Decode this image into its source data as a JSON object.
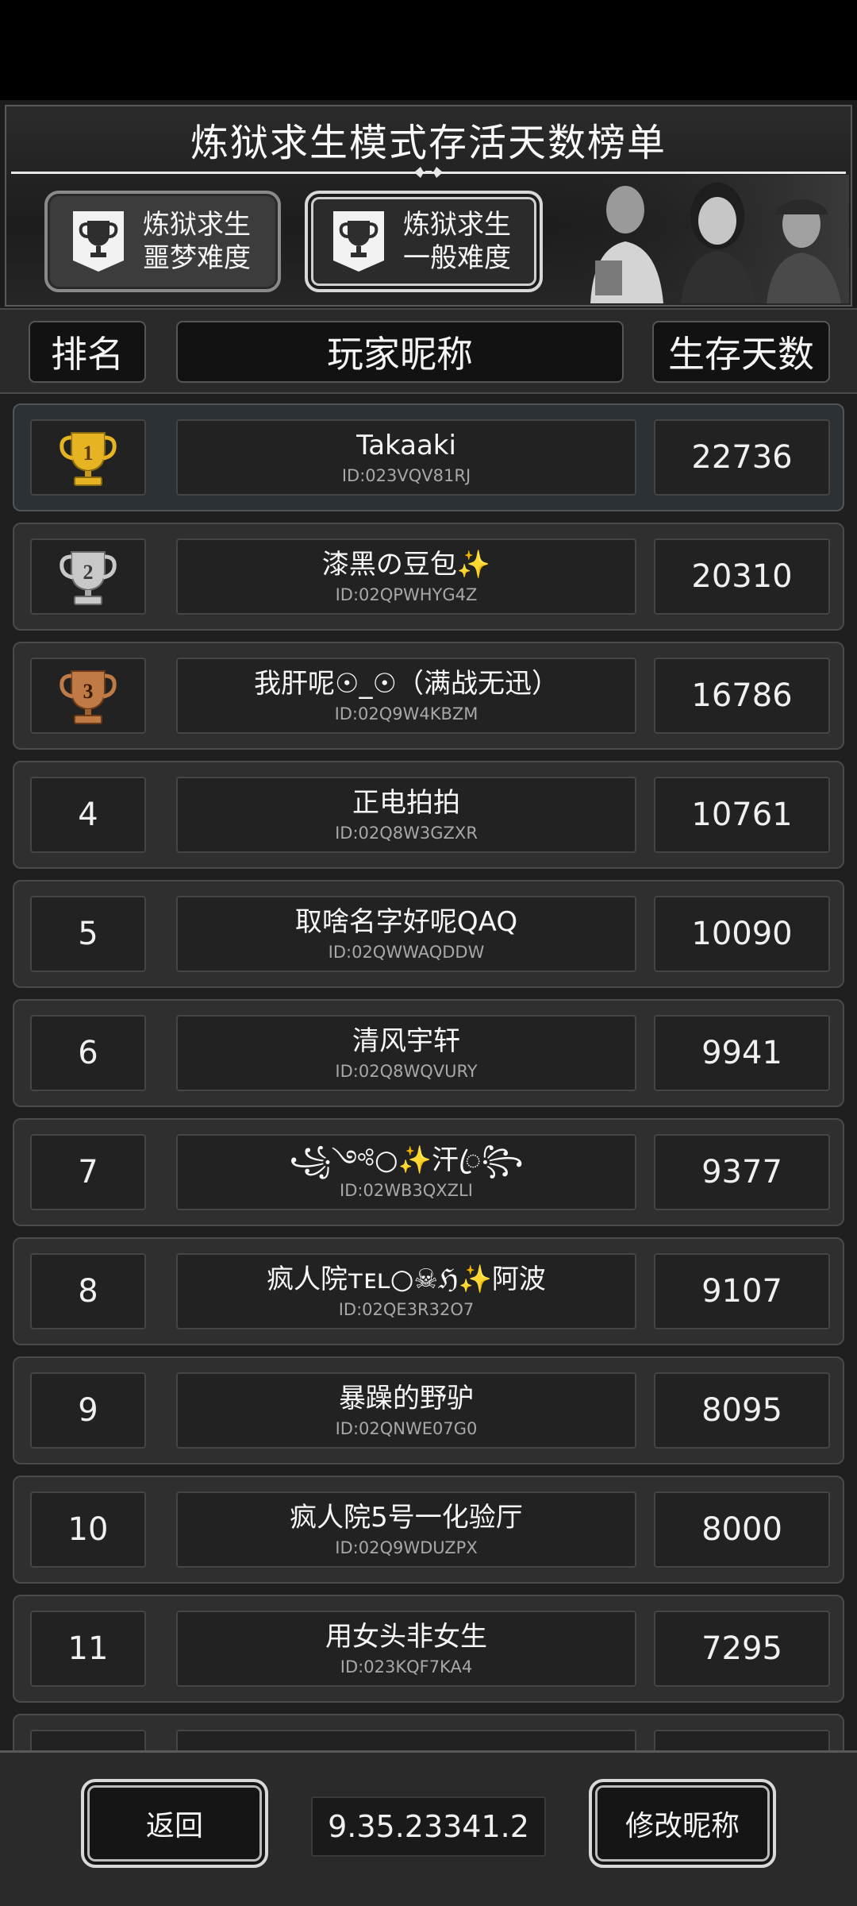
{
  "header": {
    "title": "炼狱求生模式存活天数榜单",
    "modes": [
      {
        "line1": "炼狱求生",
        "line2": "噩梦难度",
        "selected": false
      },
      {
        "line1": "炼狱求生",
        "line2": "一般难度",
        "selected": true
      }
    ]
  },
  "columns": {
    "rank": "排名",
    "nickname": "玩家昵称",
    "days": "生存天数"
  },
  "rows": [
    {
      "rank": "1",
      "medal": "gold-trophy-icon",
      "nickname": "Takaaki",
      "uid": "ID:023VQV81RJ",
      "days": "22736"
    },
    {
      "rank": "2",
      "medal": "silver-trophy-icon",
      "nickname": "漆黑の豆包✨",
      "uid": "ID:02QPWHYG4Z",
      "days": "20310"
    },
    {
      "rank": "3",
      "medal": "bronze-trophy-icon",
      "nickname": "我肝呢☉_☉（满战无迅）",
      "uid": "ID:02Q9W4KBZM",
      "days": "16786"
    },
    {
      "rank": "4",
      "nickname": "正电拍拍",
      "uid": "ID:02Q8W3GZXR",
      "days": "10761"
    },
    {
      "rank": "5",
      "nickname": "取啥名字好呢QAQ",
      "uid": "ID:02QWWAQDDW",
      "days": "10090"
    },
    {
      "rank": "6",
      "nickname": "清风宇轩",
      "uid": "ID:02Q8WQVURY",
      "days": "9941"
    },
    {
      "rank": "7",
      "nickname": "꧁༺○✨汗ꦿ꧂",
      "uid": "ID:02WB3QXZLI",
      "days": "9377"
    },
    {
      "rank": "8",
      "nickname": "疯人院ᴛᴇʟ○☠ℌ✨阿波",
      "uid": "ID:02QE3R32O7",
      "days": "9107"
    },
    {
      "rank": "9",
      "nickname": "暴躁的野驴",
      "uid": "ID:02QNWE07G0",
      "days": "8095"
    },
    {
      "rank": "10",
      "nickname": "疯人院5号一化验厅",
      "uid": "ID:02Q9WDUZPX",
      "days": "8000"
    },
    {
      "rank": "11",
      "nickname": "用女头非女生",
      "uid": "ID:023KQF7KA4",
      "days": "7295"
    }
  ],
  "footer": {
    "back_label": "返回",
    "version": "9.35.23341.2",
    "rename_label": "修改昵称"
  },
  "colors": {
    "gold": "#e6b422",
    "silver": "#c8c8c8",
    "bronze": "#c07a45",
    "accent_border": "#d8d8d8"
  }
}
